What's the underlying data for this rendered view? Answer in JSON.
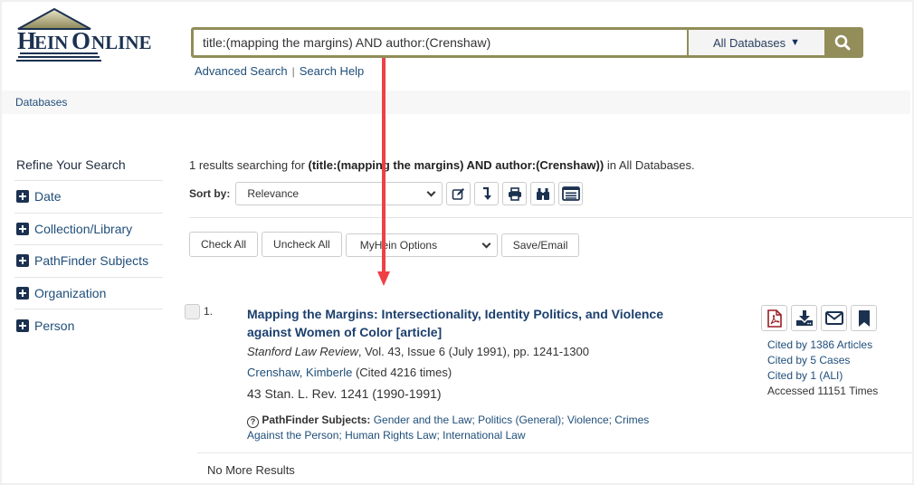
{
  "brand": {
    "logo_text": "HEINONLINE",
    "accent_color": "#928d59",
    "navy_color": "#1b3150"
  },
  "search": {
    "query": "title:(mapping the margins) AND author:(Crenshaw)",
    "scope_label": "All Databases",
    "scope_caret": "▼",
    "search_icon": "search-icon",
    "advanced_link": "Advanced Search",
    "separator": "|",
    "help_link": "Search Help"
  },
  "breadcrumb": {
    "label": "Databases"
  },
  "sidebar": {
    "title": "Refine Your Search",
    "facets": [
      {
        "label": "Date",
        "icon": "plus-square-icon"
      },
      {
        "label": "Collection/Library",
        "icon": "plus-square-icon"
      },
      {
        "label": "PathFinder Subjects",
        "icon": "plus-square-icon"
      },
      {
        "label": "Organization",
        "icon": "plus-square-icon"
      },
      {
        "label": "Person",
        "icon": "plus-square-icon"
      }
    ]
  },
  "results_summary": {
    "prefix": "1 results searching for ",
    "query": "(title:(mapping the margins) AND author:(Crenshaw))",
    "suffix": " in All Databases."
  },
  "sort": {
    "label": "Sort by:",
    "selected": "Relevance",
    "tool_icons": [
      "edit-icon",
      "sort-download-icon",
      "print-icon",
      "binoculars-icon",
      "list-view-icon"
    ]
  },
  "actions": {
    "check_all": "Check All",
    "uncheck_all": "Uncheck All",
    "myhein_selected": "MyHein Options",
    "save_email": "Save/Email"
  },
  "results": [
    {
      "number": "1.",
      "title": "Mapping the Margins: Intersectionality, Identity Politics, and Violence against Women of Color [article]",
      "journal": "Stanford Law Review",
      "citation_details": ", Vol. 43, Issue 6 (July 1991), pp. 1241-1300",
      "author": "Crenshaw, Kimberle",
      "author_cited": " (Cited 4216 times)",
      "short_citation": "43 Stan. L. Rev. 1241 (1990-1991)",
      "pathfinder_label": "PathFinder Subjects:",
      "pathfinder_subjects": "Gender and the Law; Politics (General); Violence; Crimes Against the Person; Human Rights Law; International Law",
      "icons": [
        "pdf-icon",
        "download-icon",
        "email-icon",
        "bookmark-icon"
      ],
      "stats": {
        "cited_articles": "Cited by 1386 Articles",
        "cited_cases": "Cited by 5 Cases",
        "cited_ali": "Cited by 1 (ALI)",
        "accessed": "Accessed 11151 Times"
      }
    }
  ],
  "footer": {
    "no_more": "No More Results"
  },
  "annotation": {
    "arrow_color": "#ef4046"
  }
}
